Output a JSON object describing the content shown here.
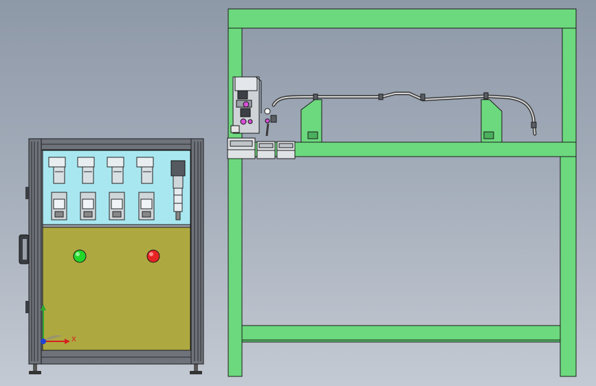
{
  "colors": {
    "background_top": "#8e99a8",
    "background_bottom": "#c4cad3",
    "frame_green": "#6cd97e",
    "outline": "#1a1a1a",
    "cabinet_panel_blue": "#a9e7f0",
    "cabinet_door_olive": "#aea840",
    "cabinet_frame_gray": "#8a8f96",
    "indicator_green": "#22d62a",
    "indicator_red": "#e52424",
    "fixture_magenta": "#d64fd6"
  },
  "triad": {
    "x_label": "X",
    "y_label": "Y"
  },
  "icons": {
    "solenoid_valve": "solenoid-valve-icon",
    "regulator": "air-regulator-icon",
    "indicator": "indicator-light-icon"
  }
}
